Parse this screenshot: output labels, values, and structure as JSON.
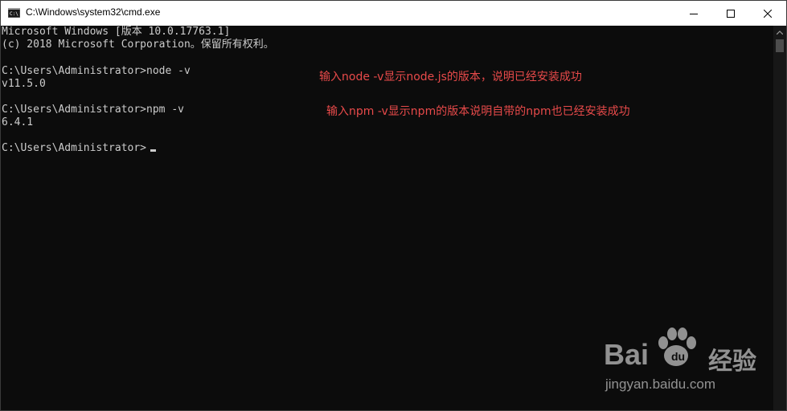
{
  "window": {
    "title": "C:\\Windows\\system32\\cmd.exe",
    "icon": "cmd-icon"
  },
  "console": {
    "lines": [
      "Microsoft Windows [版本 10.0.17763.1]",
      "(c) 2018 Microsoft Corporation。保留所有权利。",
      "",
      "C:\\Users\\Administrator>node -v",
      "v11.5.0",
      "",
      "C:\\Users\\Administrator>npm -v",
      "6.4.1",
      "",
      "C:\\Users\\Administrator>"
    ],
    "text_color": "#cccccc",
    "background_color": "#0c0c0c"
  },
  "annotations": [
    "输入node -v显示node.js的版本，说明已经安装成功",
    "输入npm -v显示npm的版本说明自带的npm也已经安装成功"
  ],
  "annotation_color": "#e84a4a",
  "watermark": {
    "brand_left": "Bai",
    "brand_right": "经验",
    "url": "jingyan.baidu.com"
  }
}
